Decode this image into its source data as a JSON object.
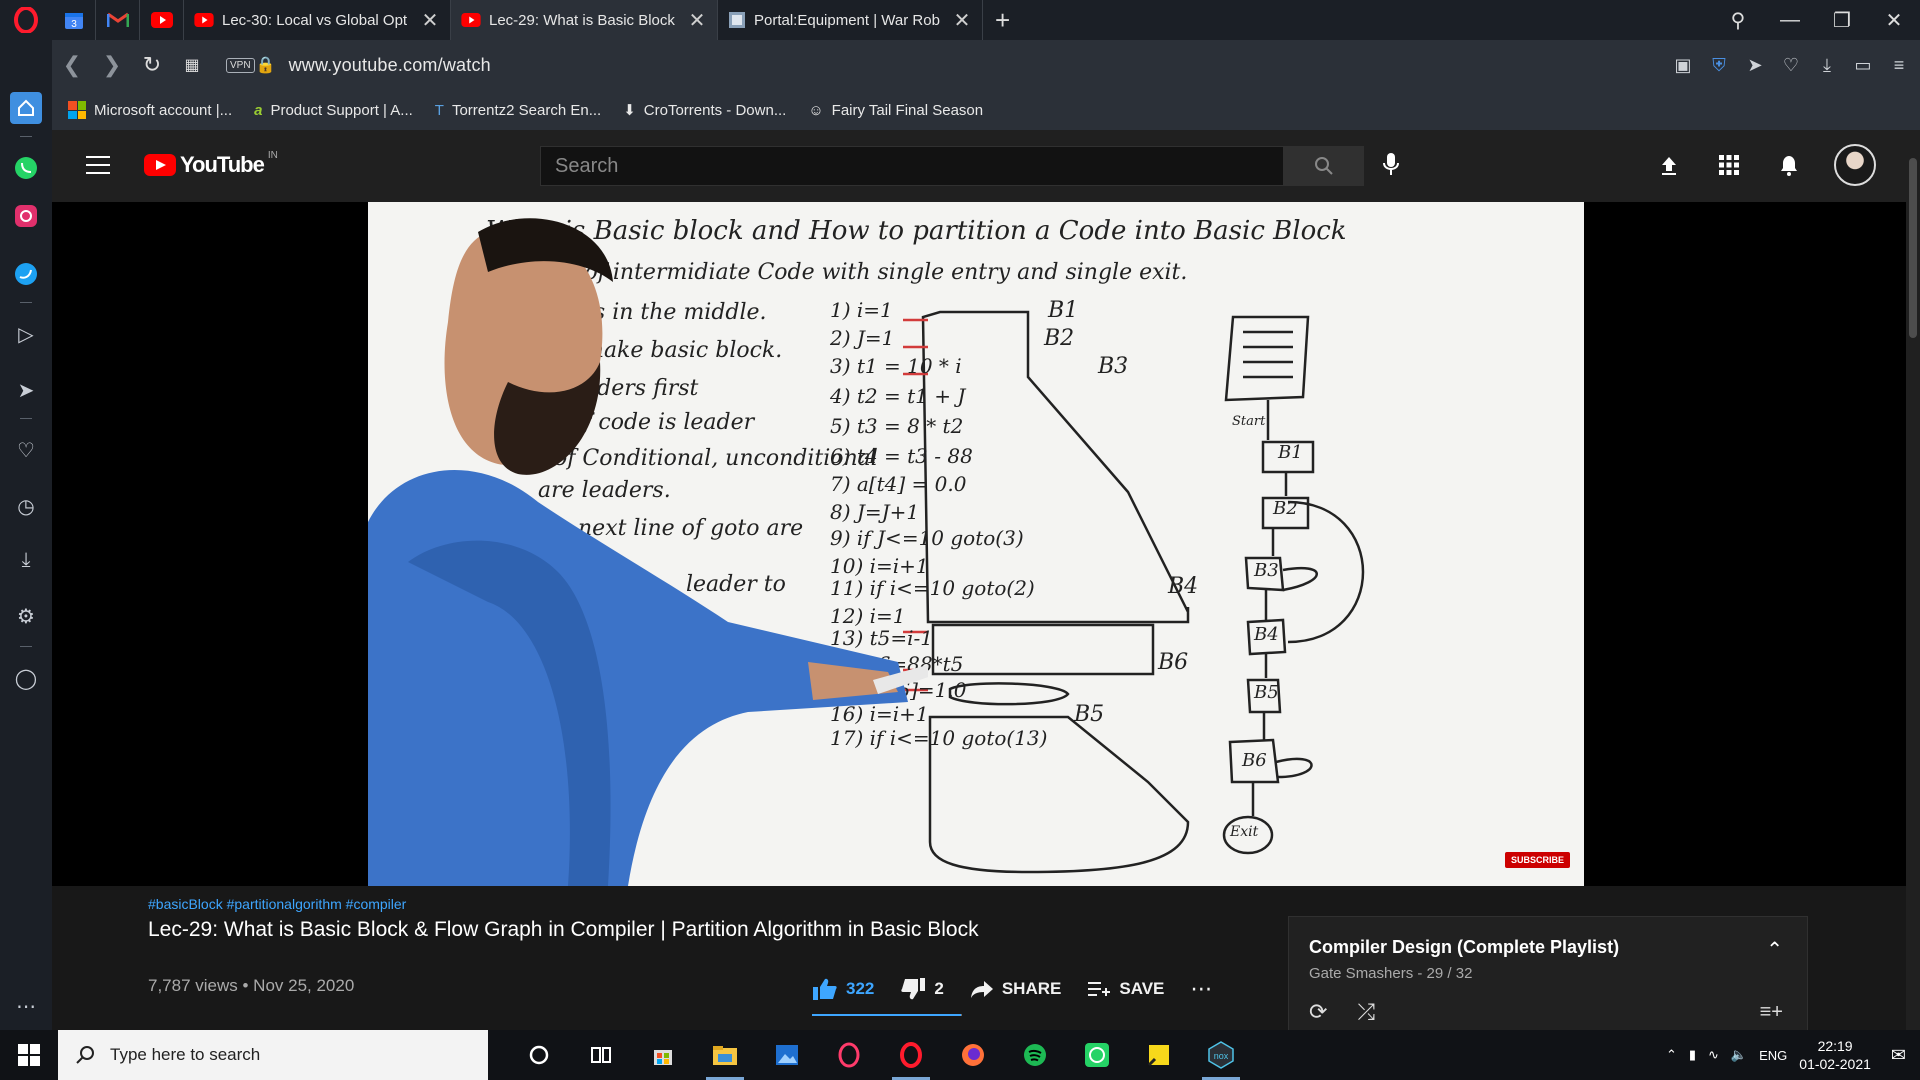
{
  "browser": {
    "tabs": [
      {
        "label": "Lec-30: Local vs Global Opt",
        "active": false
      },
      {
        "label": "Lec-29: What is Basic Block",
        "active": true
      },
      {
        "label": "Portal:Equipment | War Rob",
        "active": false
      }
    ],
    "pinned_tab_badge": "3",
    "url": "www.youtube.com/watch",
    "vpn_label": "VPN",
    "bookmarks": [
      {
        "label": "Microsoft account |...",
        "icon": "microsoft-logo"
      },
      {
        "label": "Product Support | A...",
        "icon": "product-support-icon"
      },
      {
        "label": "Torrentz2 Search En...",
        "icon": "torrentz-icon"
      },
      {
        "label": "CroTorrents - Down...",
        "icon": "download-icon"
      },
      {
        "label": "Fairy Tail Final Season",
        "icon": "fairy-tail-icon"
      }
    ]
  },
  "youtube": {
    "logo_text": "YouTube",
    "country_code": "IN",
    "search_placeholder": "Search",
    "accent": "#ff0000",
    "link_color": "#3ea6ff"
  },
  "video": {
    "whiteboard": {
      "title": "What is Basic block and How to partition a Code into Basic Block",
      "left_lines": [
        "nce of intermidiate Code with single entry and single exit.",
        "jumps in the middle.",
        "to make basic block.",
        "leaders first",
        "e of code is leader",
        "of Conditional, unconditional",
        "are leaders.",
        "next line of goto are",
        "leader to"
      ],
      "code_lines": [
        "1) i=1",
        "2) J=1",
        "3) t1 = 10 * i",
        "4) t2 = t1 + J",
        "5) t3 = 8 * t2",
        "6) t4 = t3 - 88",
        "7) a[t4] = 0.0",
        "8) J=J+1",
        "9) if J<=10 goto(3)",
        "10) i=i+1",
        "11) if i<=10 goto(2)",
        "12) i=1",
        "13) t5=i-1",
        "14) t6=88*t5",
        "15) a[t6]=1.0",
        "16) i=i+1",
        "17) if i<=10 goto(13)"
      ],
      "block_labels": [
        "B1",
        "B2",
        "B3",
        "B4",
        "B5",
        "B6"
      ],
      "flow_nodes": [
        "Start",
        "B1",
        "B2",
        "B3",
        "B4",
        "B5",
        "B6",
        "Exit"
      ]
    },
    "watermark": "SUBSCRIBE",
    "hashtags": "#basicBlock #partitionalgorithm #compiler",
    "title": "Lec-29: What is Basic Block & Flow Graph in Compiler | Partition Algorithm in Basic Block",
    "views_date": "7,787 views • Nov 25, 2020",
    "likes": "322",
    "dislikes": "2",
    "like_ratio": 0.994,
    "share_label": "SHARE",
    "save_label": "SAVE"
  },
  "playlist": {
    "title": "Compiler Design (Complete Playlist)",
    "subtitle": "Gate Smashers - 29 / 32"
  },
  "taskbar": {
    "search_placeholder": "Type here to search",
    "language": "ENG",
    "time": "22:19",
    "date": "01-02-2021"
  }
}
